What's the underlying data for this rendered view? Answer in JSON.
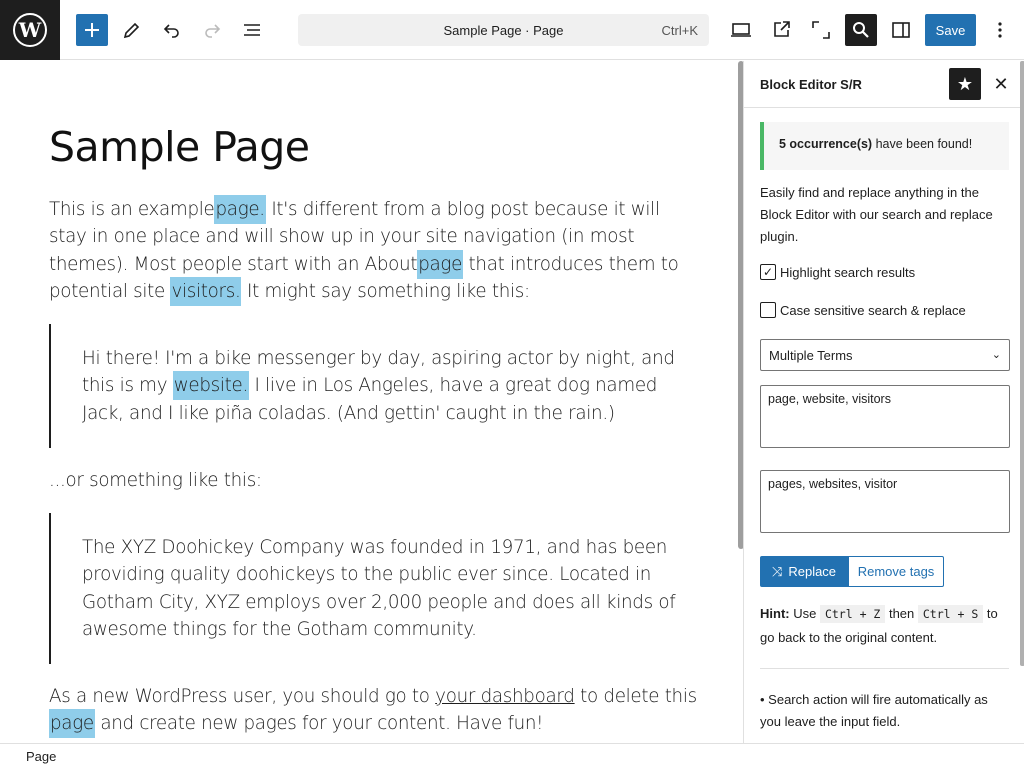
{
  "toolbar": {
    "document_title": "Sample Page · Page",
    "shortcut": "Ctrl+K",
    "save_label": "Save"
  },
  "editor": {
    "title": "Sample Page",
    "p1": [
      {
        "t": "This is an example"
      },
      {
        "t": "page.",
        "hl": true
      },
      {
        "t": " It's different from a blog post because it will stay in one place and will show up in your site navigation (in most themes). Most people start with an About"
      },
      {
        "t": "page",
        "hl": true
      },
      {
        "t": " that introduces them to potential site "
      },
      {
        "t": "visitors.",
        "hl": true
      },
      {
        "t": " It might say something like this:"
      }
    ],
    "q1": [
      {
        "t": "Hi there! I'm a bike messenger by day, aspiring actor by night, and this is my "
      },
      {
        "t": "website.",
        "hl": true
      },
      {
        "t": " I live in Los Angeles, have a great dog named Jack, and I like piña coladas. (And gettin' caught in the rain.)"
      }
    ],
    "p2": "...or something like this:",
    "q2": "The XYZ Doohickey Company was founded in 1971, and has been providing quality doohickeys to the public ever since. Located in Gotham City, XYZ employs over 2,000 people and does all kinds of awesome things for the Gotham community.",
    "p3_before": "As a new WordPress user, you should go to ",
    "p3_link": "your dashboard",
    "p3_mid": " to delete this ",
    "p3_hl": "page",
    "p3_after": " and create new pages for your content. Have fun!"
  },
  "sidebar": {
    "title": "Block Editor S/R",
    "notice_count": "5 occurrence(s)",
    "notice_rest": " have been found!",
    "description": "Easily find and replace anything in the Block Editor with our search and replace plugin.",
    "highlight_label": "Highlight search results",
    "highlight_checked": true,
    "case_label": "Case sensitive search & replace",
    "case_checked": false,
    "mode_selected": "Multiple Terms",
    "search_value": "page, website, visitors",
    "replace_value": "pages, websites, visitor",
    "replace_label": "Replace",
    "remove_tags_label": "Remove tags",
    "hint_label": "Hint:",
    "hint_use": " Use ",
    "hint_key1": "Ctrl + Z",
    "hint_then": " then ",
    "hint_key2": "Ctrl + S",
    "hint_rest": " to go back to the original content.",
    "note": "• Search action will fire automatically as you leave the input field."
  },
  "footer": {
    "breadcrumb": "Page"
  },
  "colors": {
    "accent": "#2271b1",
    "highlight": "#8fcdea",
    "success": "#4ab866"
  }
}
